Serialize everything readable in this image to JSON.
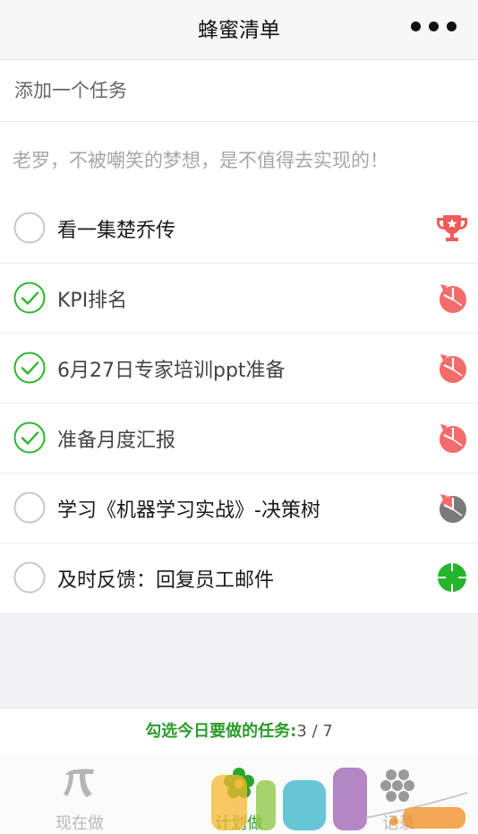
{
  "nav": {
    "title": "蜂蜜清单",
    "more_icon": "more-dots-icon"
  },
  "add_task": {
    "placeholder": "添加一个任务",
    "value": ""
  },
  "motto": "老罗，不被嘲笑的梦想，是不值得去实现的！",
  "tasks": [
    {
      "label": "看一集楚乔传",
      "checked": false,
      "icon": "trophy-icon",
      "icon_color": "#f15a5a"
    },
    {
      "label": "KPI排名",
      "checked": true,
      "icon": "clock-alarm-icon",
      "icon_color": "#f46b6b"
    },
    {
      "label": "6月27日专家培训ppt准备",
      "checked": true,
      "icon": "clock-alarm-icon",
      "icon_color": "#f46b6b"
    },
    {
      "label": "准备月度汇报",
      "checked": true,
      "icon": "clock-alarm-icon",
      "icon_color": "#f46b6b"
    },
    {
      "label": "学习《机器学习实战》-决策树",
      "checked": false,
      "icon": "clock-alarm-gray-icon",
      "icon_color": "#7a7a7a"
    },
    {
      "label": "及时反馈：回复员工邮件",
      "checked": false,
      "icon": "target-icon",
      "icon_color": "#25b52c"
    }
  ],
  "footer": {
    "prefix": "勾选今日要做的任务:",
    "count": "3 / 7"
  },
  "tabs": [
    {
      "label": "现在做",
      "icon": "pi-icon",
      "active": false
    },
    {
      "label": "计划做",
      "icon": "flower-icon",
      "active": true
    },
    {
      "label": "记录",
      "icon": "hexagon-cluster-icon",
      "active": false
    }
  ],
  "colors": {
    "accent": "#2aa52a",
    "check_green": "#2db52d",
    "alarm_red": "#f46b6b"
  }
}
